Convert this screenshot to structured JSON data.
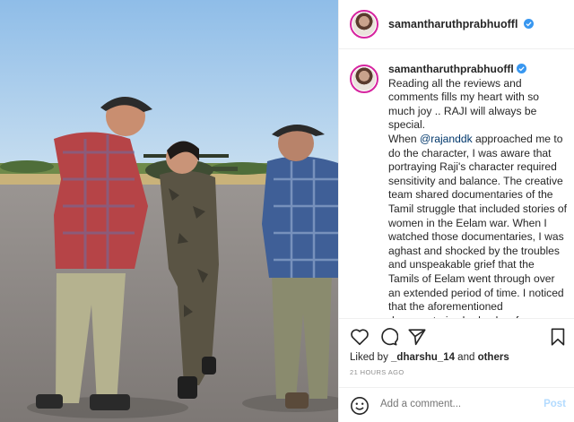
{
  "photo": {
    "alt_icon": "photo-three-people-on-airstrip"
  },
  "header": {
    "username": "samantharuthprabhuoffl",
    "verified_icon": "verified-badge-icon"
  },
  "caption": {
    "username": "samantharuthprabhuoffl",
    "line1_after_user": "Reading all the reviews and comments fills my heart with so much joy .. RAJI will always be special.",
    "p2_before_mention": "When ",
    "mention": "@rajanddk",
    "p2_after_mention": " approached me to do the character, I was aware that portraying Raji's character required sensitivity and balance. The creative team shared documentaries of the Tamil struggle that included stories of women in the Eelam war. When I watched those documentaries, I was aghast and shocked by the troubles and unspeakable grief that the Tamils of Eelam went through over an extended period of time. I noticed that the aforementioned documentaries had only a few thousand views and that is when it dawned on me how the world just looked away when tens of thousands people of"
  },
  "actions": {
    "like_icon": "heart-icon",
    "comment_icon": "comment-icon",
    "share_icon": "share-icon",
    "save_icon": "bookmark-icon",
    "liked_prefix": "Liked by ",
    "liked_user": "_dharshu_14",
    "liked_mid": " and ",
    "liked_others": "others",
    "timestamp": "21 HOURS AGO"
  },
  "add_comment": {
    "emoji_icon": "emoji-icon",
    "placeholder": "Add a comment...",
    "post_label": "Post"
  },
  "colors": {
    "link": "#00376b",
    "muted": "#8e8e8e",
    "post_disabled": "#b3dbff",
    "verified": "#3897f0"
  }
}
